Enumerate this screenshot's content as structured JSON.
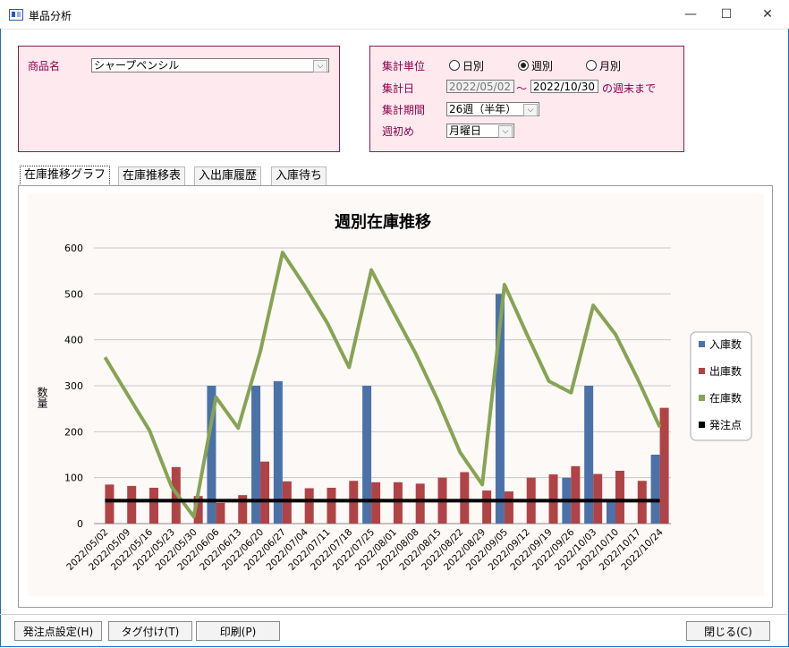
{
  "window": {
    "title": "単品分析",
    "minimize": "—",
    "maximize": "☐",
    "close": "✕"
  },
  "product": {
    "label": "商品名",
    "value": "シャープペンシル"
  },
  "settings": {
    "unit_label": "集計単位",
    "unit_options": [
      {
        "label": "日別",
        "selected": false
      },
      {
        "label": "週別",
        "selected": true
      },
      {
        "label": "月別",
        "selected": false
      }
    ],
    "date_label": "集計日",
    "date_from": "2022/05/02",
    "tilde": "～",
    "date_to": "2022/10/30",
    "date_suffix": "の週末まで",
    "period_label": "集計期間",
    "period_value": "26週（半年）",
    "weekstart_label": "週初め",
    "weekstart_value": "月曜日"
  },
  "tabs": [
    {
      "label": "在庫推移グラフ",
      "active": true
    },
    {
      "label": "在庫推移表",
      "active": false
    },
    {
      "label": "入出庫履歴",
      "active": false
    },
    {
      "label": "入庫待ち",
      "active": false
    }
  ],
  "buttons": {
    "reorder": "発注点設定(H)",
    "tag": "タグ付け(T)",
    "print": "印刷(P)",
    "close": "閉じる(C)"
  },
  "chart_data": {
    "type": "bar",
    "title": "週別在庫推移",
    "ylabel": "数量",
    "ylim": [
      0,
      600
    ],
    "yticks": [
      0,
      100,
      200,
      300,
      400,
      500,
      600
    ],
    "grid": true,
    "legend_position": "right",
    "categories": [
      "2022/05/02",
      "2022/05/09",
      "2022/05/16",
      "2022/05/23",
      "2022/05/30",
      "2022/06/06",
      "2022/06/13",
      "2022/06/20",
      "2022/06/27",
      "2022/07/04",
      "2022/07/11",
      "2022/07/18",
      "2022/07/25",
      "2022/08/01",
      "2022/08/08",
      "2022/08/15",
      "2022/08/22",
      "2022/08/29",
      "2022/09/05",
      "2022/09/12",
      "2022/09/19",
      "2022/09/26",
      "2022/10/03",
      "2022/10/10",
      "2022/10/17",
      "2022/10/24"
    ],
    "series": [
      {
        "name": "入庫数",
        "kind": "bar",
        "color": "#4a72a8",
        "values": [
          0,
          0,
          0,
          0,
          0,
          300,
          0,
          300,
          310,
          0,
          0,
          0,
          300,
          0,
          0,
          0,
          0,
          0,
          500,
          0,
          0,
          100,
          300,
          50,
          0,
          150
        ]
      },
      {
        "name": "出庫数",
        "kind": "bar",
        "color": "#b04346",
        "values": [
          85,
          82,
          78,
          123,
          60,
          45,
          62,
          135,
          92,
          77,
          78,
          93,
          90,
          90,
          87,
          100,
          112,
          72,
          70,
          100,
          107,
          125,
          108,
          115,
          93,
          252
        ]
      },
      {
        "name": "在庫数",
        "kind": "line",
        "color": "#86a453",
        "values": [
          362,
          282,
          203,
          80,
          15,
          275,
          208,
          375,
          590,
          517,
          438,
          340,
          552,
          460,
          370,
          268,
          155,
          85,
          520,
          413,
          310,
          285,
          475,
          412,
          315,
          210
        ]
      },
      {
        "name": "発注点",
        "kind": "line",
        "color": "#000000",
        "values": [
          50,
          50,
          50,
          50,
          50,
          50,
          50,
          50,
          50,
          50,
          50,
          50,
          50,
          50,
          50,
          50,
          50,
          50,
          50,
          50,
          50,
          50,
          50,
          50,
          50,
          50
        ]
      }
    ]
  }
}
